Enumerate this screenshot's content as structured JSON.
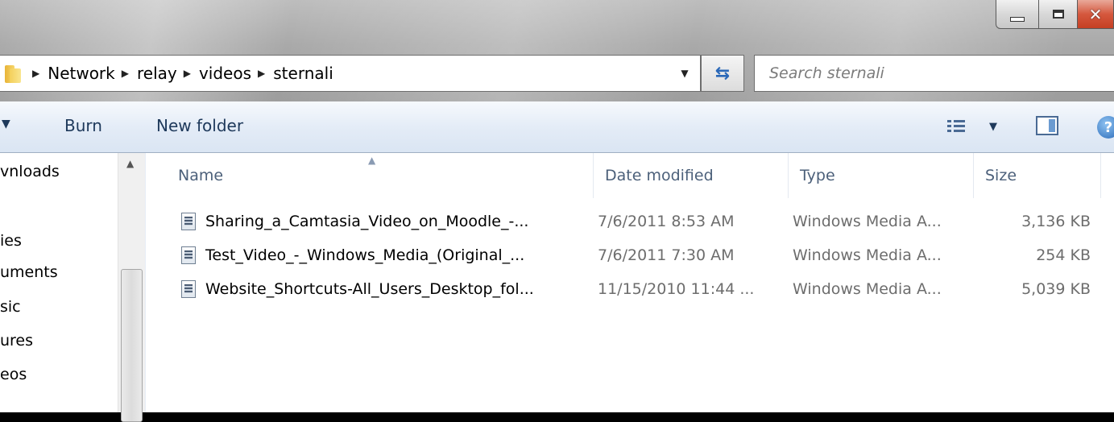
{
  "address_bar": {
    "breadcrumbs": [
      "Network",
      "relay",
      "videos",
      "sternali"
    ]
  },
  "search": {
    "placeholder": "Search sternali"
  },
  "command_bar": {
    "burn_label": "Burn",
    "new_folder_label": "New folder"
  },
  "nav_pane": {
    "items": [
      "vnloads",
      "ies",
      "uments",
      "sic",
      "ures",
      "eos"
    ]
  },
  "file_list": {
    "columns": [
      "Name",
      "Date modified",
      "Type",
      "Size"
    ],
    "rows": [
      {
        "name": "Sharing_a_Camtasia_Video_on_Moodle_-...",
        "date": "7/6/2011 8:53 AM",
        "type": "Windows Media A...",
        "size": "3,136 KB"
      },
      {
        "name": "Test_Video_-_Windows_Media_(Original_...",
        "date": "7/6/2011 7:30 AM",
        "type": "Windows Media A...",
        "size": "254 KB"
      },
      {
        "name": "Website_Shortcuts-All_Users_Desktop_fol...",
        "date": "11/15/2010 11:44 ...",
        "type": "Windows Media A...",
        "size": "5,039 KB"
      }
    ]
  },
  "colors": {
    "command_bar_text": "#1e395b",
    "close_button": "#c53f23",
    "metadata_text": "#6d6d6d"
  }
}
